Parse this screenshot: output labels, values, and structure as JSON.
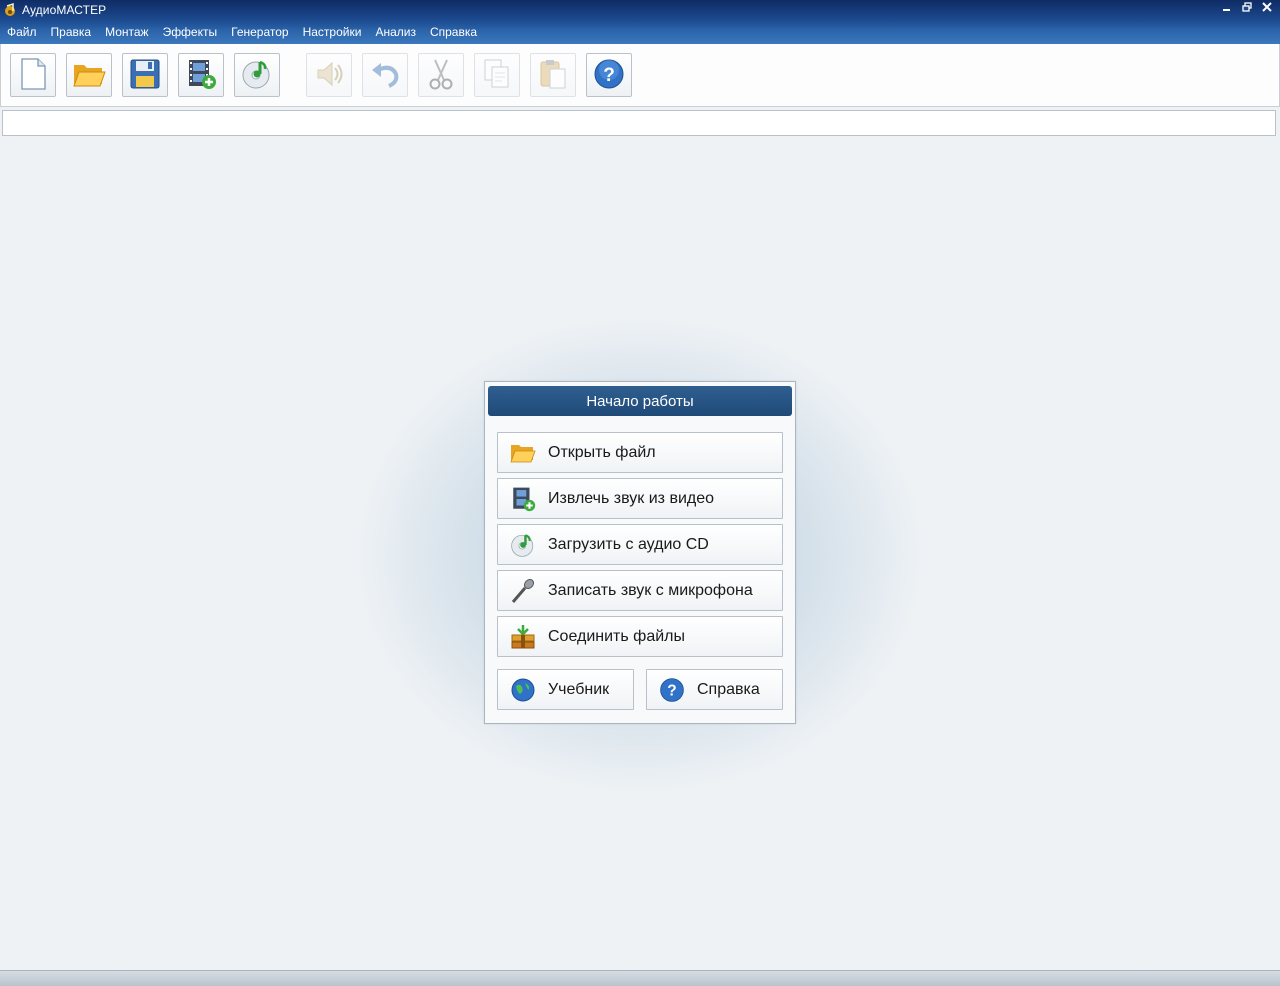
{
  "window": {
    "title": "АудиоМАСТЕР",
    "controls": [
      "minimize",
      "restore",
      "close"
    ]
  },
  "menu": {
    "items": [
      "Файл",
      "Правка",
      "Монтаж",
      "Эффекты",
      "Генератор",
      "Настройки",
      "Анализ",
      "Справка"
    ]
  },
  "toolbar": {
    "buttons": [
      {
        "icon": "new-file-icon",
        "enabled": true
      },
      {
        "icon": "open-folder-icon",
        "enabled": true
      },
      {
        "icon": "save-disk-icon",
        "enabled": true
      },
      {
        "icon": "extract-video-icon",
        "enabled": true
      },
      {
        "icon": "audio-cd-icon",
        "enabled": true
      },
      {
        "icon": "speaker-play-icon",
        "enabled": false
      },
      {
        "icon": "undo-icon",
        "enabled": false
      },
      {
        "icon": "cut-scissors-icon",
        "enabled": false
      },
      {
        "icon": "copy-icon",
        "enabled": false
      },
      {
        "icon": "paste-icon",
        "enabled": false
      },
      {
        "icon": "help-icon",
        "enabled": true
      }
    ]
  },
  "start_panel": {
    "title": "Начало работы",
    "buttons": {
      "open_file": "Открыть файл",
      "extract_video": "Извлечь звук из видео",
      "load_cd": "Загрузить с аудио CD",
      "record_mic": "Записать звук с микрофона",
      "join_files": "Соединить файлы",
      "tutorial": "Учебник",
      "help": "Справка"
    }
  },
  "colors": {
    "title_bar": "#0f2b64",
    "menu_bar": "#2a62a8",
    "panel_header": "#2f5f90",
    "workspace": "#eef2f5"
  }
}
